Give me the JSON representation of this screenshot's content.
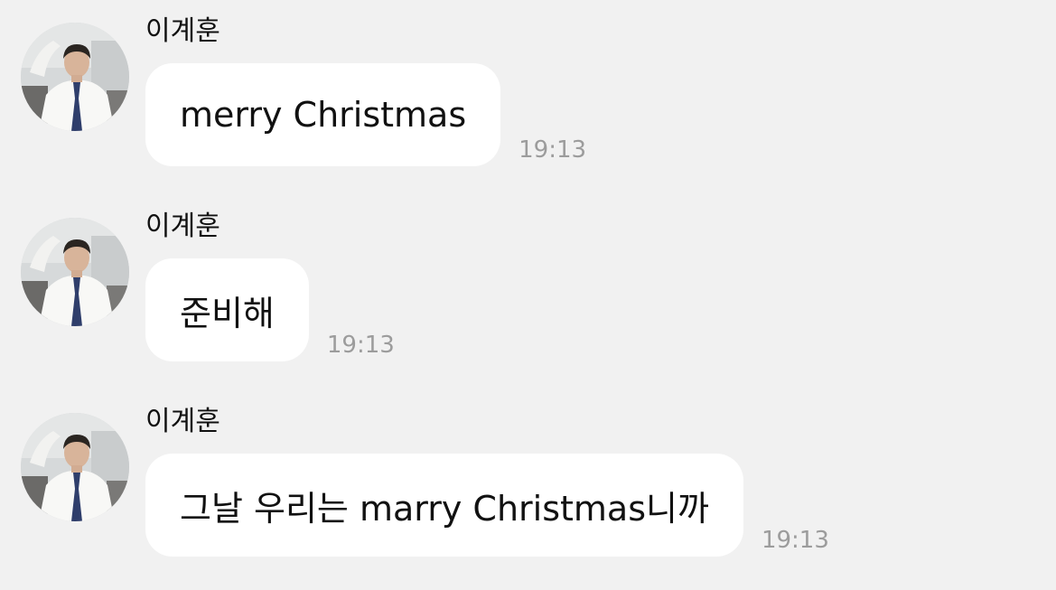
{
  "chat": {
    "messages": [
      {
        "sender": "이계훈",
        "avatar_icon": "profile-photo",
        "text": "merry Christmas",
        "time": "19:13"
      },
      {
        "sender": "이계훈",
        "avatar_icon": "profile-photo",
        "text": "준비해",
        "time": "19:13"
      },
      {
        "sender": "이계훈",
        "avatar_icon": "profile-photo",
        "text": "그날 우리는 marry Christmas니까",
        "time": "19:13"
      }
    ]
  },
  "colors": {
    "background": "#f1f1f1",
    "bubble": "#ffffff",
    "text": "#111111",
    "timestamp": "#9c9c9c"
  }
}
